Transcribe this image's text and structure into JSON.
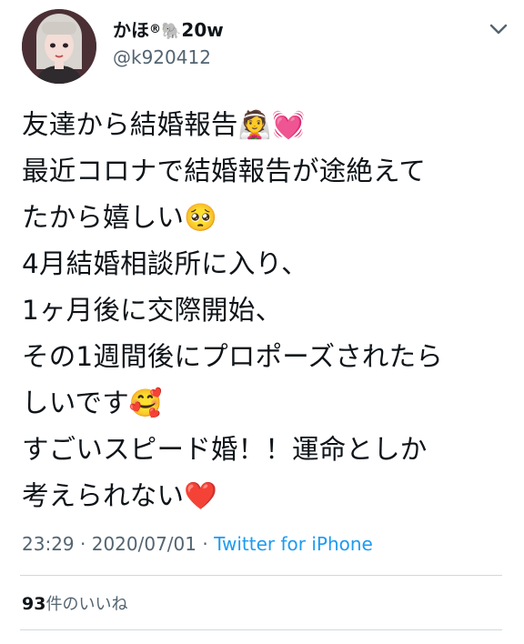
{
  "user": {
    "display_name": "かほ",
    "registered_mark": "®",
    "name_emoji": "🐘",
    "name_suffix": "20w",
    "handle": "@k920412"
  },
  "tweet": {
    "lines": [
      "友達から結婚報告👰💓",
      "最近コロナで結婚報告が途絶えて",
      "たから嬉しい🥺",
      "4月結婚相談所に入り、",
      "1ヶ月後に交際開始、",
      "その1週間後にプロポーズされたら",
      "しいです🥰",
      "すごいスピード婚！！運命としか",
      "考えられない❤️"
    ]
  },
  "meta": {
    "time": "23:29",
    "separator": " · ",
    "date": "2020/07/01",
    "source": "Twitter for iPhone"
  },
  "engagement": {
    "likes_count": "93",
    "likes_label": "件のいいね"
  },
  "icons": {
    "more": "more-icon",
    "avatar": "avatar"
  }
}
